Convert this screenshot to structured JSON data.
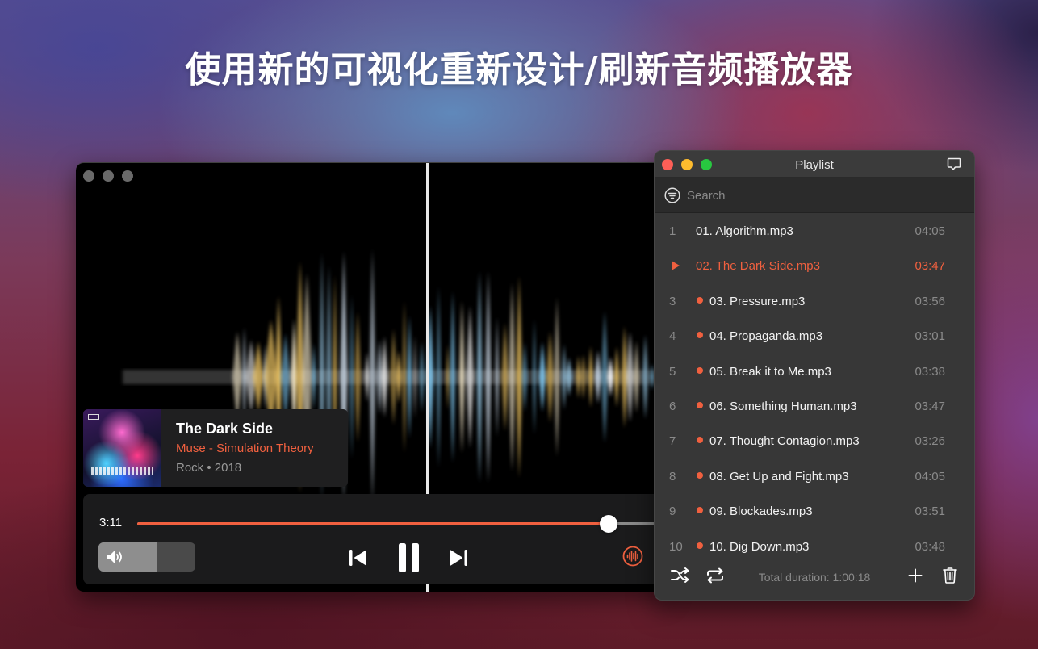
{
  "headline": "使用新的可视化重新设计/刷新音频播放器",
  "player": {
    "track": {
      "title": "The Dark Side",
      "artist_album": "Muse - Simulation Theory",
      "genre_year": "Rock • 2018"
    },
    "elapsed": "3:11",
    "progress": 0.885,
    "volume": 0.6,
    "accent_color": "#f0603f",
    "icons": {
      "prev": "skip-previous-icon",
      "pause": "pause-icon",
      "next": "skip-next-icon",
      "volume": "speaker-icon",
      "visualizer": "waveform-icon"
    }
  },
  "playlist": {
    "title": "Playlist",
    "search_placeholder": "Search",
    "now_playing_index": 1,
    "tracks": [
      {
        "num": "1",
        "name": "01. Algorithm.mp3",
        "duration": "04:05",
        "queued": false
      },
      {
        "num": "2",
        "name": "02. The Dark Side.mp3",
        "duration": "03:47",
        "queued": false
      },
      {
        "num": "3",
        "name": "03. Pressure.mp3",
        "duration": "03:56",
        "queued": true
      },
      {
        "num": "4",
        "name": "04. Propaganda.mp3",
        "duration": "03:01",
        "queued": true
      },
      {
        "num": "5",
        "name": "05. Break it to Me.mp3",
        "duration": "03:38",
        "queued": true
      },
      {
        "num": "6",
        "name": "06. Something Human.mp3",
        "duration": "03:47",
        "queued": true
      },
      {
        "num": "7",
        "name": "07. Thought Contagion.mp3",
        "duration": "03:26",
        "queued": true
      },
      {
        "num": "8",
        "name": "08. Get Up and Fight.mp3",
        "duration": "04:05",
        "queued": true
      },
      {
        "num": "9",
        "name": "09. Blockades.mp3",
        "duration": "03:51",
        "queued": true
      },
      {
        "num": "10",
        "name": "10. Dig Down.mp3",
        "duration": "03:48",
        "queued": true
      }
    ],
    "total_duration": "Total duration: 1:00:18"
  }
}
